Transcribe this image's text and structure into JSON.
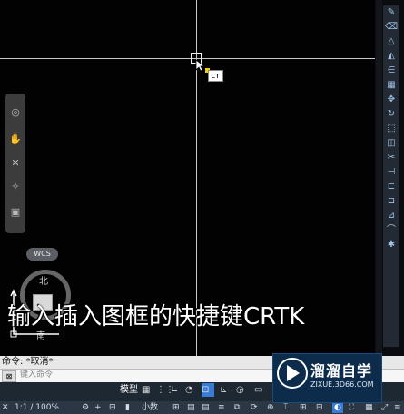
{
  "canvas": {
    "tooltip_text": "cr",
    "ucs_label": "WCS",
    "compass_north": "北",
    "compass_south": "南",
    "subtitle": "输入插入图框的快捷键CRTK"
  },
  "command": {
    "history": "命令: *取消*",
    "prompt": "键入命令",
    "input_icon": "⊠"
  },
  "status": {
    "tabs": [
      "模型"
    ],
    "scale": "1:1 / 100%",
    "units": "小数",
    "icons": [
      "grid-icon",
      "snap-icon",
      "ortho-icon",
      "polar-icon",
      "osnap-icon",
      "annotate-icon",
      "workspace-icon",
      "settings-icon",
      "fullscreen-icon"
    ]
  },
  "right_toolbar": {
    "icons": [
      "pencil-icon",
      "erase-icon",
      "copy-icon",
      "mirror-icon",
      "offset-icon",
      "array-icon",
      "move-icon",
      "rotate-icon",
      "scale-icon",
      "stretch-icon",
      "trim-icon",
      "extend-icon",
      "break-icon",
      "join-icon",
      "chamfer-icon",
      "fillet-icon",
      "explode-icon"
    ]
  },
  "watermark": {
    "title": "溜溜自学",
    "url": "ZIXUE.3D66.COM"
  },
  "colors": {
    "canvas_bg": "#020202",
    "crosshair": "#c9c9c9",
    "statusbar_bg": "#1d2833",
    "accent": "#3a7bd5"
  }
}
